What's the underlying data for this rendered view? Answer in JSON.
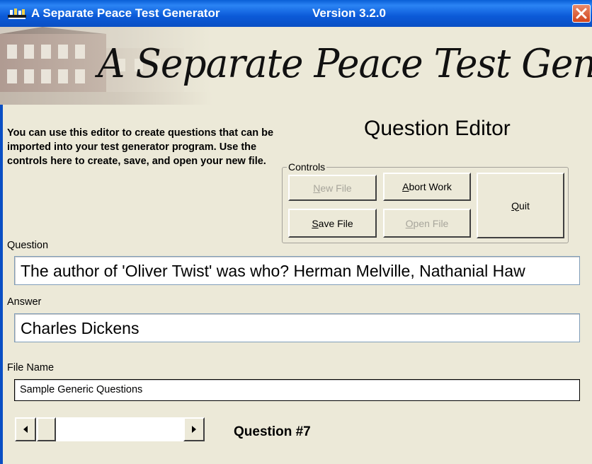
{
  "window": {
    "title": "A Separate Peace Test Generator",
    "version": "Version 3.2.0",
    "icon": "books-icon",
    "close_icon": "close-icon",
    "accent": "#0a5fd6",
    "close_color": "#d2441c"
  },
  "banner": {
    "text": "A Separate Peace Test Generator"
  },
  "intro": {
    "text": "You can use this editor to create questions that can be imported into your test generator program.  Use the controls here to create, save, and open your new file."
  },
  "heading": "Question Editor",
  "controls": {
    "legend": "Controls",
    "buttons": {
      "new_file": {
        "prefix": "",
        "mnemonic": "N",
        "suffix": "ew File",
        "enabled": false
      },
      "abort_work": {
        "prefix": "",
        "mnemonic": "A",
        "suffix": "bort Work",
        "enabled": true
      },
      "quit": {
        "prefix": "",
        "mnemonic": "Q",
        "suffix": "uit",
        "enabled": true
      },
      "save_file": {
        "prefix": "",
        "mnemonic": "S",
        "suffix": "ave File",
        "enabled": true
      },
      "open_file": {
        "prefix": "",
        "mnemonic": "O",
        "suffix": "pen File",
        "enabled": false
      }
    }
  },
  "fields": {
    "question": {
      "label": "Question",
      "value": "The author of 'Oliver Twist' was who? Herman Melville, Nathanial Haw"
    },
    "answer": {
      "label": "Answer",
      "value": "Charles Dickens"
    },
    "file_name": {
      "label": "File Name",
      "value": "Sample Generic Questions"
    }
  },
  "navigator": {
    "label": "Question #7",
    "left_icon": "arrow-left-icon",
    "right_icon": "arrow-right-icon"
  }
}
